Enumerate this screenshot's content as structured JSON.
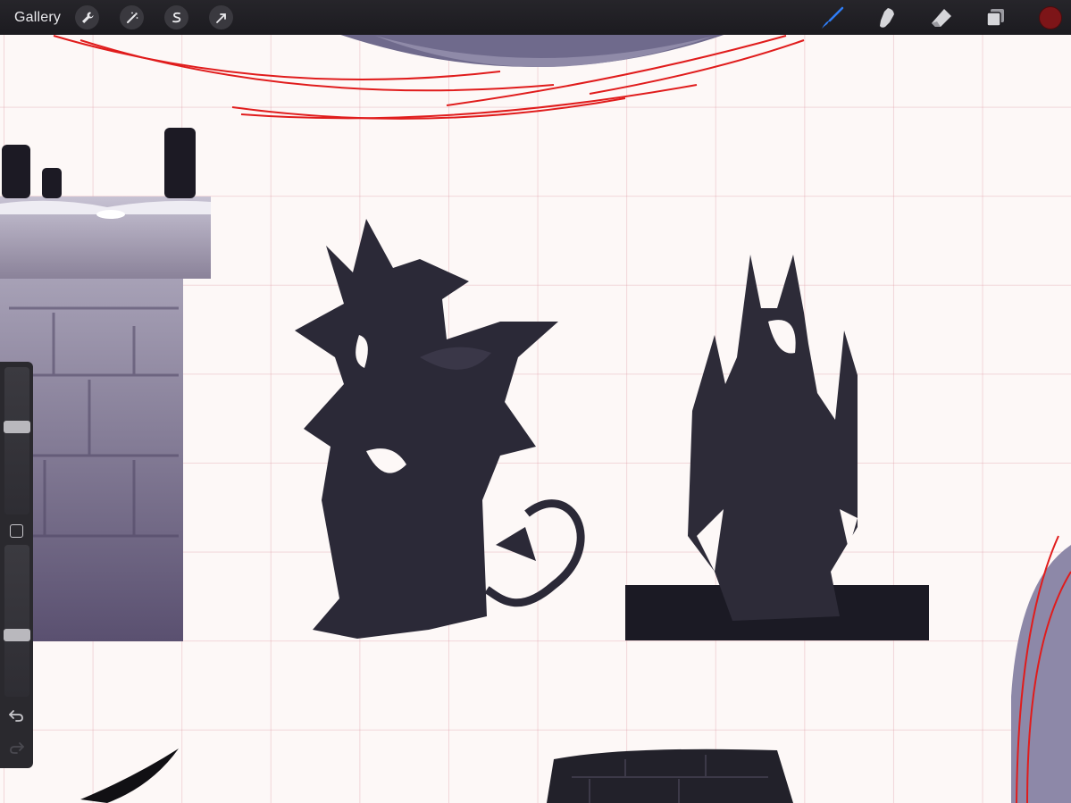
{
  "topbar": {
    "gallery_label": "Gallery",
    "left_tools": [
      "wrench-icon",
      "magic-wand-icon",
      "selection-icon",
      "transform-arrow-icon"
    ],
    "right_tools": [
      "brush-icon",
      "smudge-icon",
      "eraser-icon",
      "layers-icon"
    ],
    "active_tool": "brush-icon",
    "active_tool_color": "#2f7df6",
    "current_color": "#7d1518"
  },
  "sidebar": {
    "brush_size": 0.6,
    "brush_opacity": 0.4,
    "icons": [
      "undo-icon",
      "redo-icon",
      "modify-square-icon"
    ]
  }
}
